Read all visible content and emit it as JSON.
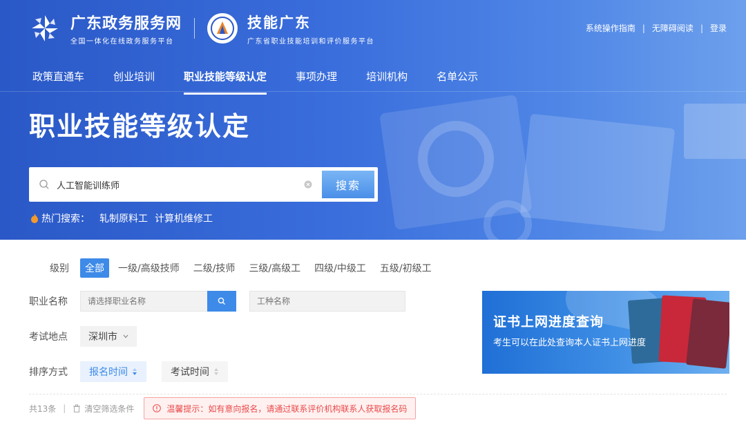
{
  "header": {
    "site_name": "广东政务服务网",
    "site_sub": "全国一体化在线政务服务平台",
    "brand_name": "技能广东",
    "brand_sub": "广东省职业技能培训和评价服务平台",
    "links": [
      "系统操作指南",
      "无障碍阅读",
      "登录"
    ]
  },
  "nav": {
    "items": [
      "政策直通车",
      "创业培训",
      "职业技能等级认定",
      "事项办理",
      "培训机构",
      "名单公示"
    ],
    "active": 2
  },
  "hero": {
    "title": "职业技能等级认定",
    "search_value": "人工智能训练师",
    "search_button": "搜索",
    "hot_label": "热门搜索：",
    "hot_items": [
      "轧制原料工",
      "计算机维修工"
    ]
  },
  "filters": {
    "level_label": "级别",
    "levels": [
      "全部",
      "一级/高级技师",
      "二级/技师",
      "三级/高级工",
      "四级/中级工",
      "五级/初级工"
    ],
    "job_label": "职业名称",
    "job_placeholder": "请选择职业名称",
    "type_placeholder": "工种名称",
    "location_label": "考试地点",
    "location_value": "深圳市",
    "sort_label": "排序方式",
    "sort_options": [
      "报名时间",
      "考试时间"
    ]
  },
  "results": {
    "count": "共13条",
    "clear_label": "清空筛选条件",
    "tip": "温馨提示：如有意向报名，请通过联系评价机构联系人获取报名码"
  },
  "cert_banner": {
    "title": "证书上网进度查询",
    "subtitle": "考生可以在此处查询本人证书上网进度"
  },
  "colors": {
    "accent": "#3d8ae8",
    "hero_blue": "#2a58c7",
    "tip_red": "#e84a4a"
  }
}
